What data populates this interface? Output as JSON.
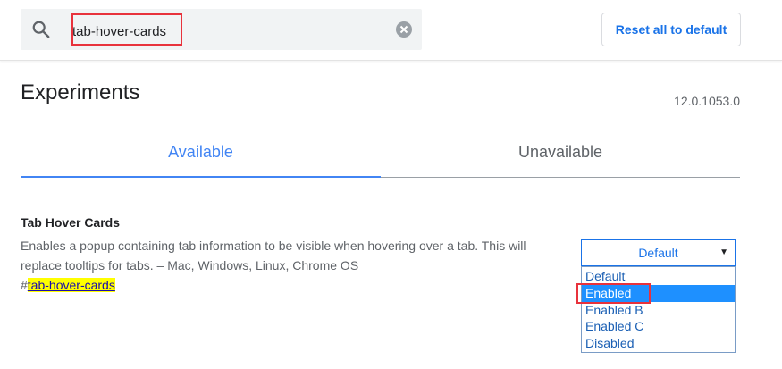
{
  "header": {
    "search_value": "tab-hover-cards",
    "reset_label": "Reset all to default"
  },
  "page": {
    "title": "Experiments",
    "version": "12.0.1053.0"
  },
  "tabs": [
    {
      "label": "Available",
      "active": true
    },
    {
      "label": "Unavailable",
      "active": false
    }
  ],
  "experiment": {
    "title": "Tab Hover Cards",
    "description": "Enables a popup containing tab information to be visible when hovering over a tab. This will replace tooltips for tabs. – Mac, Windows, Linux, Chrome OS",
    "link_hash": "#",
    "link_tag": "tab-hover-cards",
    "select_value": "Default",
    "options": [
      "Default",
      "Enabled",
      "Enabled B",
      "Enabled C",
      "Disabled"
    ],
    "selected_option": "Enabled"
  },
  "colors": {
    "accent": "#4285f4",
    "highlight_box": "#e8323c",
    "tag_highlight": "#ffff00",
    "option_selected_bg": "#1e90ff"
  }
}
